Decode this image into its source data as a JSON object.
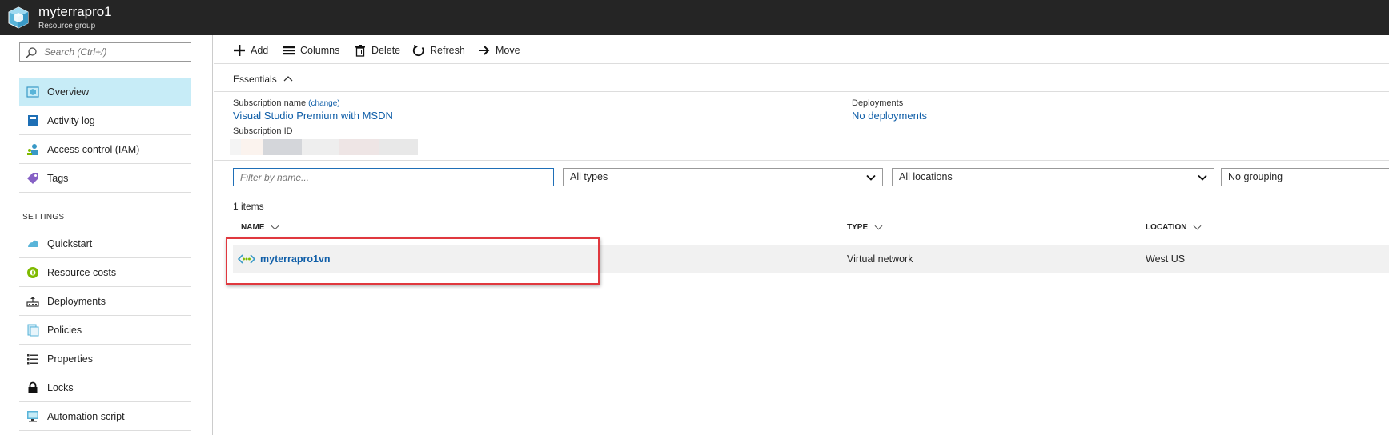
{
  "header": {
    "title": "myterrapro1",
    "subtitle": "Resource group"
  },
  "sidebar": {
    "search_placeholder": "Search (Ctrl+/)",
    "items": [
      {
        "label": "Overview",
        "icon": "overview-icon",
        "active": true
      },
      {
        "label": "Activity log",
        "icon": "activity-log-icon"
      },
      {
        "label": "Access control (IAM)",
        "icon": "iam-icon"
      },
      {
        "label": "Tags",
        "icon": "tag-icon"
      }
    ],
    "settings_heading": "SETTINGS",
    "settings_items": [
      {
        "label": "Quickstart",
        "icon": "quickstart-icon"
      },
      {
        "label": "Resource costs",
        "icon": "resource-costs-icon"
      },
      {
        "label": "Deployments",
        "icon": "deployments-icon"
      },
      {
        "label": "Policies",
        "icon": "policies-icon"
      },
      {
        "label": "Properties",
        "icon": "properties-icon"
      },
      {
        "label": "Locks",
        "icon": "lock-icon"
      },
      {
        "label": "Automation script",
        "icon": "automation-script-icon"
      }
    ]
  },
  "toolbar": {
    "add": "Add",
    "columns": "Columns",
    "delete": "Delete",
    "refresh": "Refresh",
    "move": "Move"
  },
  "essentials": {
    "label": "Essentials",
    "subscription_name_label": "Subscription name",
    "change_link": "(change)",
    "subscription_name": "Visual Studio Premium with MSDN",
    "subscription_id_label": "Subscription ID",
    "deployments_label": "Deployments",
    "deployments_value": "No deployments"
  },
  "filters": {
    "name_placeholder": "Filter by name...",
    "type": "All types",
    "location": "All locations",
    "grouping": "No grouping"
  },
  "items_count": "1 items",
  "table": {
    "columns": [
      "NAME",
      "TYPE",
      "LOCATION"
    ],
    "rows": [
      {
        "name": "myterrapro1vn",
        "type": "Virtual network",
        "location": "West US"
      }
    ]
  },
  "colors": {
    "topbar": "#252525",
    "active_nav": "#c7ecf7",
    "link": "#0f5ea8",
    "highlight": "#e0383e"
  }
}
